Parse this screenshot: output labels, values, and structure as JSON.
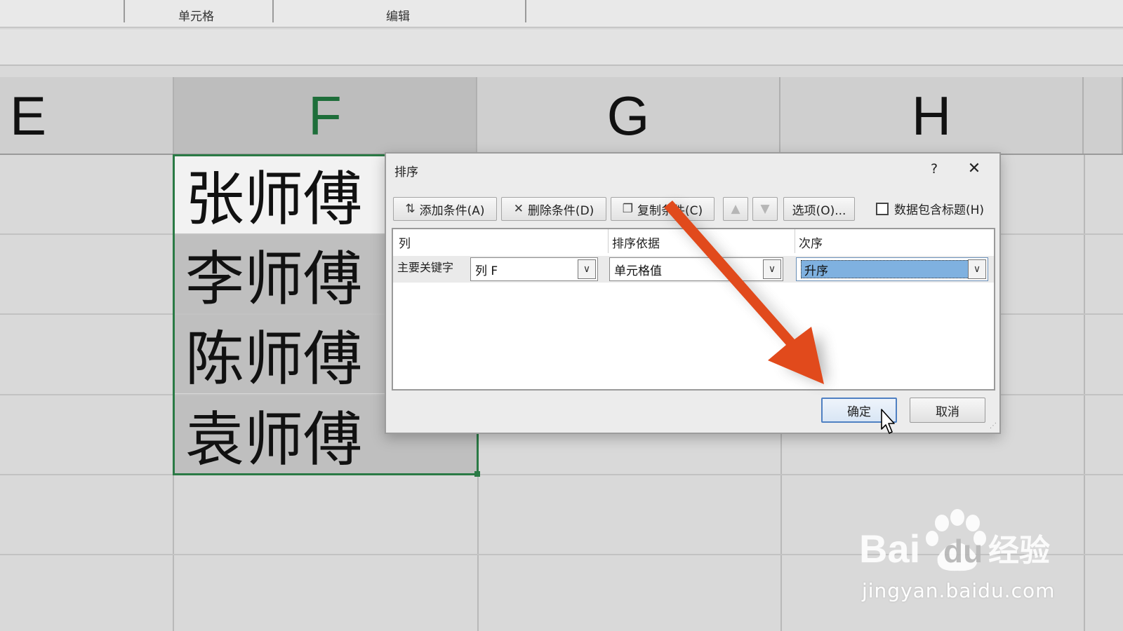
{
  "ribbon": {
    "groups": [
      "单元格",
      "编辑"
    ]
  },
  "columns": [
    "E",
    "F",
    "G",
    "H"
  ],
  "cells": [
    "张师傅",
    "李师傅",
    "陈师傅",
    "袁师傅"
  ],
  "dialog": {
    "title": "排序",
    "help": "?",
    "close": "✕",
    "toolbar": {
      "add": "添加条件(A)",
      "delete": "删除条件(D)",
      "copy": "复制条件(C)",
      "options": "选项(O)...",
      "header_checkbox": "数据包含标题(H)"
    },
    "grid": {
      "col_header": "列",
      "sort_on_header": "排序依据",
      "order_header": "次序",
      "row_label": "主要关键字",
      "column_value": "列 F",
      "sort_on_value": "单元格值",
      "order_value": "升序"
    },
    "ok": "确定",
    "cancel": "取消"
  },
  "watermark": {
    "logo_text": "Bai",
    "logo_text2": "du",
    "brand_cn": "经验",
    "url": "jingyan.baidu.com"
  },
  "colors": {
    "selection_green": "#2a7a45",
    "arrow_red": "#e14a1c",
    "highlight_blue": "#7fb1e0"
  }
}
